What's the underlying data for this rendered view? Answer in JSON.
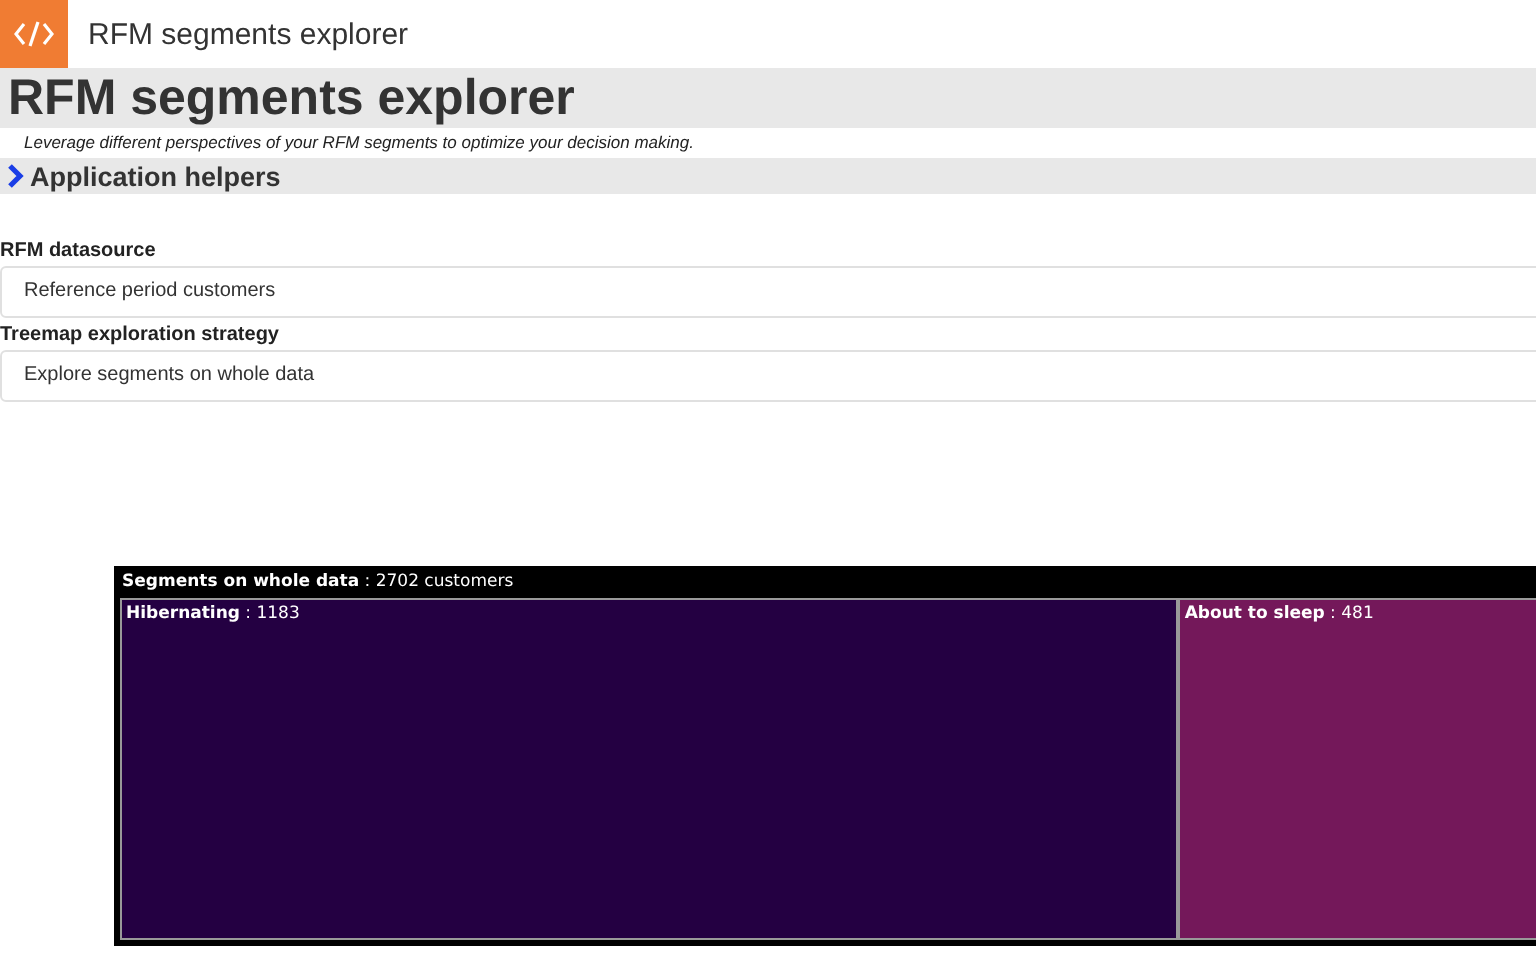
{
  "app_bar": {
    "title": "RFM segments explorer"
  },
  "header": {
    "title": "RFM segments explorer",
    "subtitle": "Leverage different perspectives of your RFM segments to optimize your decision making."
  },
  "helpers": {
    "label": "Application helpers",
    "expanded": false
  },
  "fields": [
    {
      "label": "RFM datasource",
      "value": "Reference period customers"
    },
    {
      "label": "Treemap exploration strategy",
      "value": "Explore segments on whole data"
    }
  ],
  "treemap": {
    "title": "Segments on whole data",
    "separator": ":",
    "total": "2702 customers",
    "segments": [
      {
        "name": "Hibernating",
        "separator": ":",
        "count": "1183",
        "color": "#240042"
      },
      {
        "name": "About to sleep",
        "separator": ":",
        "count": "481",
        "color": "#74185a"
      }
    ]
  }
}
